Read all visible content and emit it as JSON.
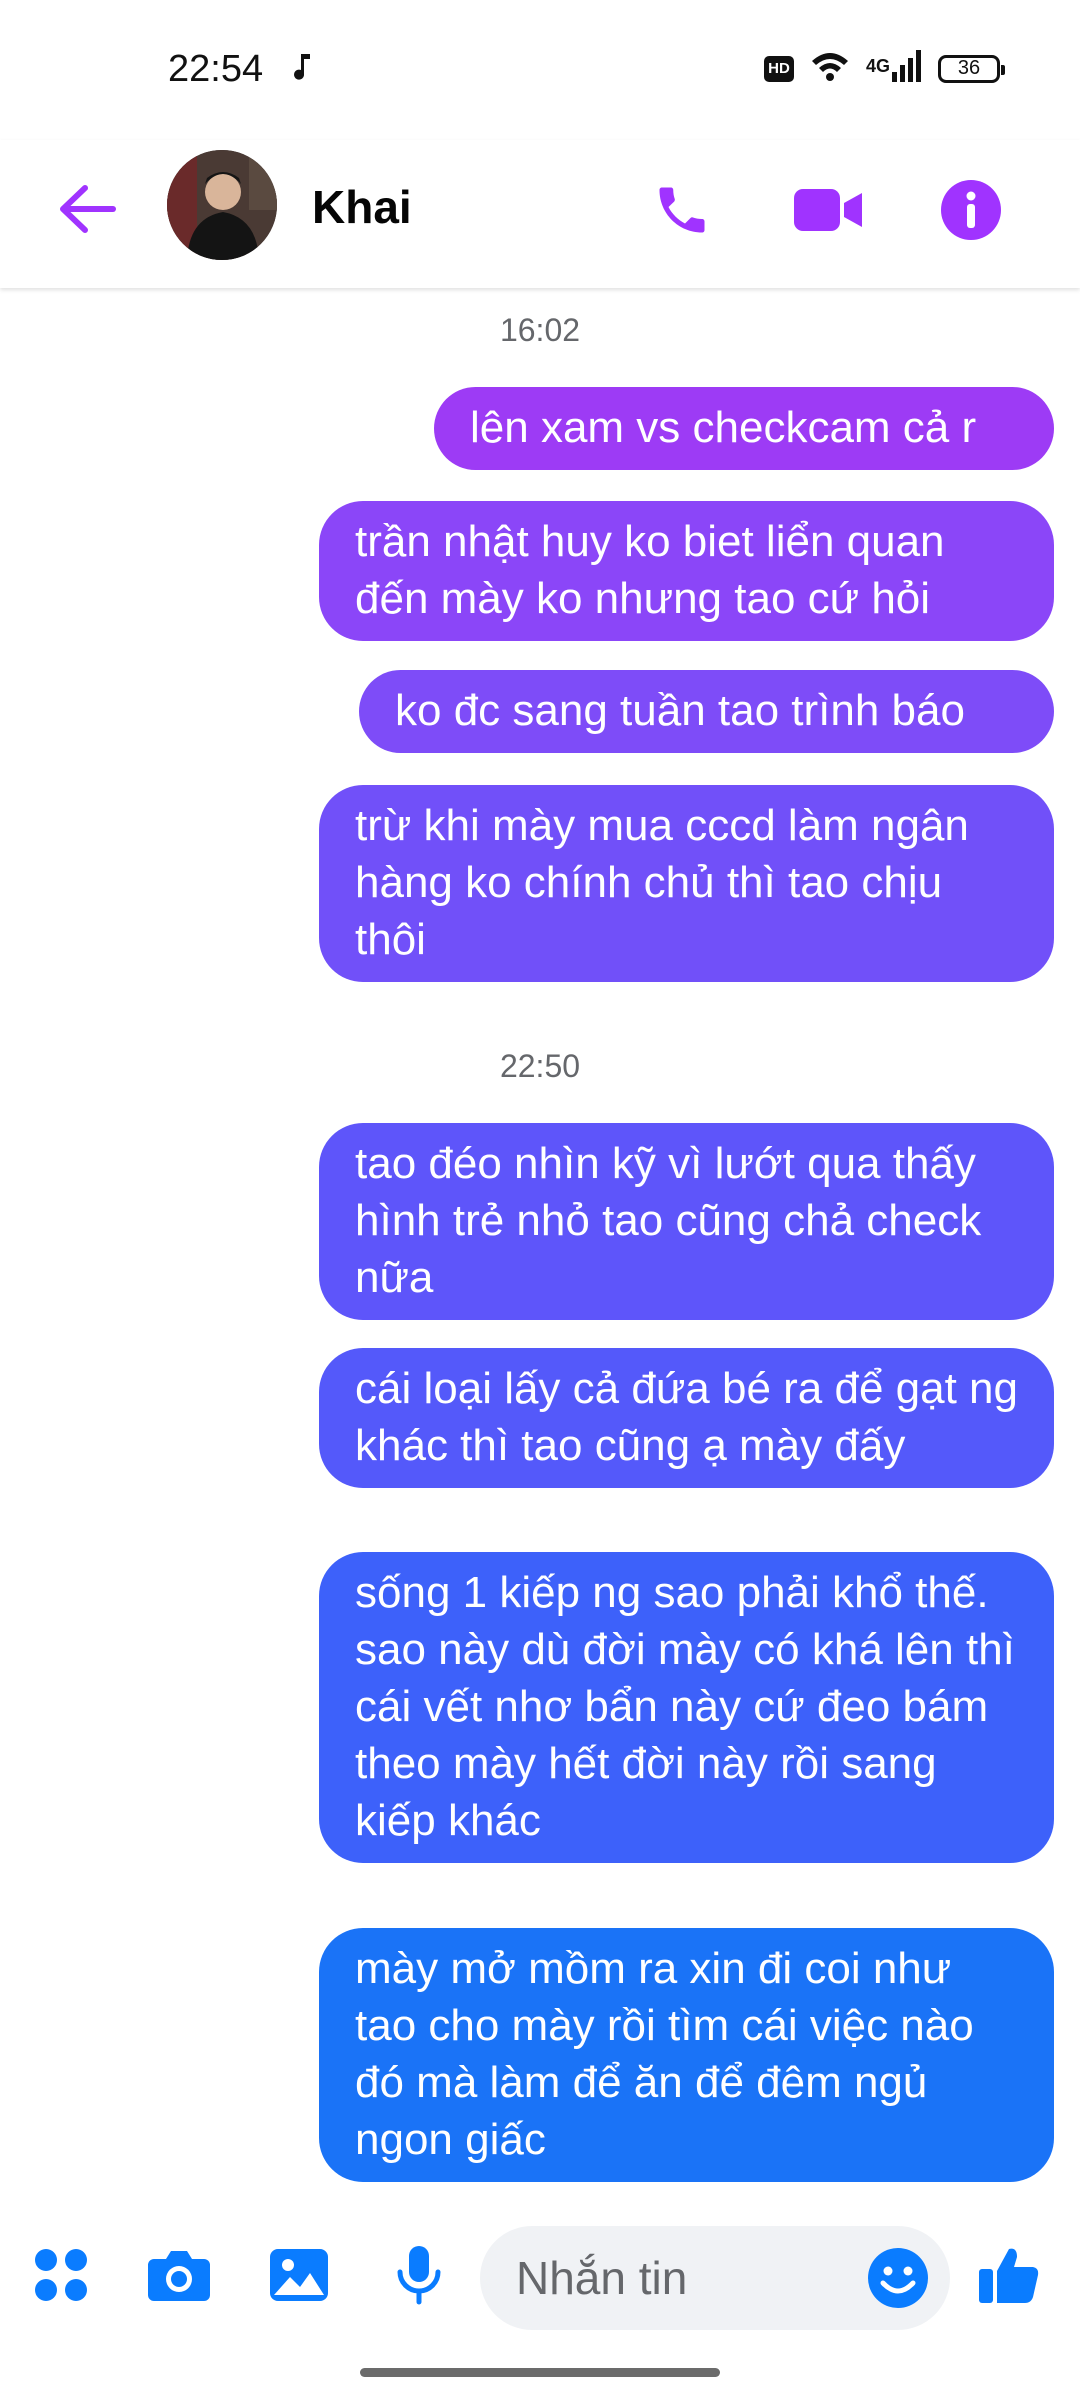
{
  "status_bar": {
    "time": "22:54",
    "note_icon": "music-note-icon",
    "hd": "HD",
    "network": "4G",
    "battery": "36"
  },
  "header": {
    "contact_name": "Khai",
    "accent_color": "#a033ff"
  },
  "conversation": [
    {
      "type": "timestamp",
      "text": "16:02"
    },
    {
      "type": "message",
      "sender": "me",
      "text": "lên xam vs checkcam cả r",
      "color": "#9d3bf5"
    },
    {
      "type": "message",
      "sender": "me",
      "text": "trần nhật huy ko biet liển quan đến mày ko nhưng tao cứ hỏi",
      "color": "#8b46f8"
    },
    {
      "type": "message",
      "sender": "me",
      "text": "ko đc sang tuần tao trình báo",
      "color": "#7e4cf8"
    },
    {
      "type": "message",
      "sender": "me",
      "text": "trừ khi mày mua cccd làm ngân hàng ko chính chủ thì tao chịu thôi",
      "color": "#7150f9"
    },
    {
      "type": "timestamp",
      "text": "22:50"
    },
    {
      "type": "message",
      "sender": "me",
      "text": "tao đéo nhìn kỹ vì lướt qua thấy hình trẻ nhỏ tao cũng chả check nữa",
      "color": "#5e55fa"
    },
    {
      "type": "message",
      "sender": "me",
      "text": "cái loại lấy cả đứa bé ra để gạt ng khác thì tao cũng ạ mày đấy",
      "color": "#5459fa"
    },
    {
      "type": "message",
      "sender": "me",
      "text": "sống 1 kiếp ng sao phải khổ thế. sao này dù đời mày có khá lên thì cái vết nhơ bẩn này cứ đeo bám theo mày hết đời này rồi sang kiếp khác",
      "color": "#3d61fa"
    },
    {
      "type": "message",
      "sender": "me",
      "text": "mày mở mồm ra xin đi coi như tao cho mày rồi tìm cái việc nào đó mà làm để ăn để đêm ngủ ngon giấc",
      "color": "#1a73f7"
    }
  ],
  "composer": {
    "placeholder": "Nhắn tin",
    "icon_color": "#0a7cff",
    "icons": [
      "apps-icon",
      "camera-icon",
      "gallery-icon",
      "microphone-icon",
      "emoji-icon",
      "thumbs-up-icon"
    ]
  }
}
